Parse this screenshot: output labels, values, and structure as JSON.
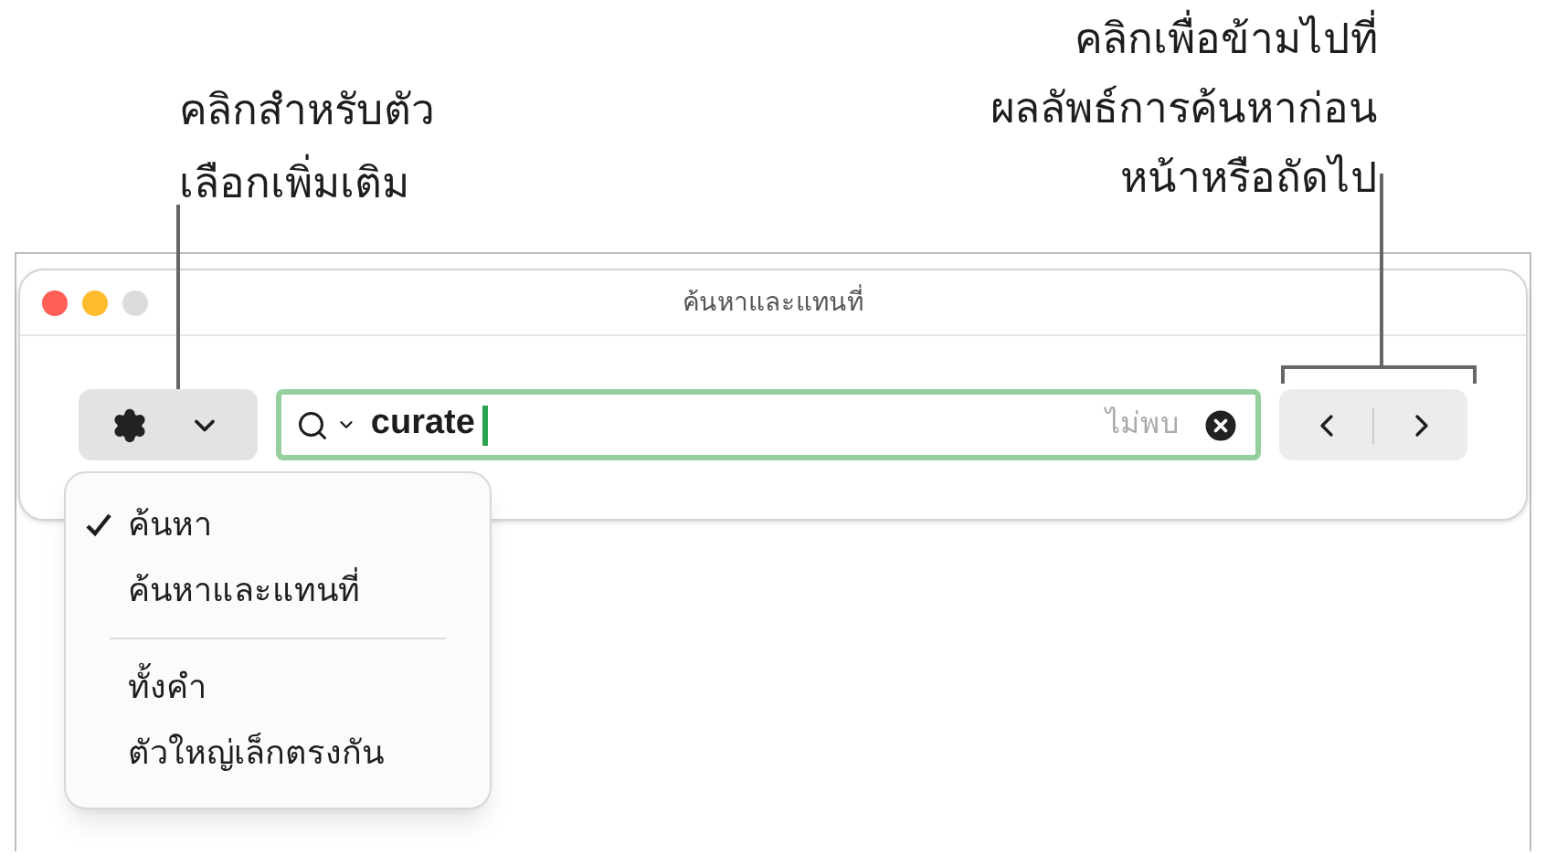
{
  "callouts": [
    {
      "lines": [
        "คลิกสำหรับตัว",
        "เลือกเพิ่มเติม"
      ]
    },
    {
      "lines": [
        "คลิกเพื่อข้ามไปที่",
        "ผลลัพธ์การค้นหาก่อน",
        "หน้าหรือถัดไป"
      ]
    }
  ],
  "window": {
    "title": "ค้นหาและแทนที่"
  },
  "search": {
    "value": "curate",
    "status": "ไม่พบ"
  },
  "menu": {
    "groups": [
      [
        {
          "label": "ค้นหา",
          "checked": true
        },
        {
          "label": "ค้นหาและแทนที่",
          "checked": false
        }
      ],
      [
        {
          "label": "ทั้งคำ",
          "checked": false
        },
        {
          "label": "ตัวใหญ่เล็กตรงกัน",
          "checked": false
        }
      ]
    ]
  }
}
